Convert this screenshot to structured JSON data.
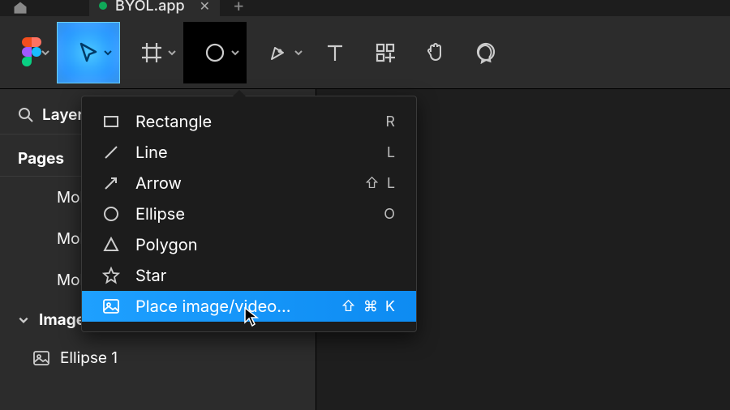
{
  "tab": {
    "title": "BYOL.app"
  },
  "sidebar": {
    "search_label": "Layers",
    "pages_label": "Pages",
    "pages": [
      "Mobile",
      "Mobile",
      "Mobile"
    ],
    "section_label": "Images in Shapes",
    "layers": [
      "Ellipse 1"
    ]
  },
  "shape_menu": {
    "items": [
      {
        "label": "Rectangle",
        "shortcut": "R"
      },
      {
        "label": "Line",
        "shortcut": "L"
      },
      {
        "label": "Arrow",
        "shortcut": "⇧ L"
      },
      {
        "label": "Ellipse",
        "shortcut": "O"
      },
      {
        "label": "Polygon",
        "shortcut": ""
      },
      {
        "label": "Star",
        "shortcut": ""
      },
      {
        "label": "Place image/video...",
        "shortcut": "⇧ ⌘ K"
      }
    ]
  }
}
